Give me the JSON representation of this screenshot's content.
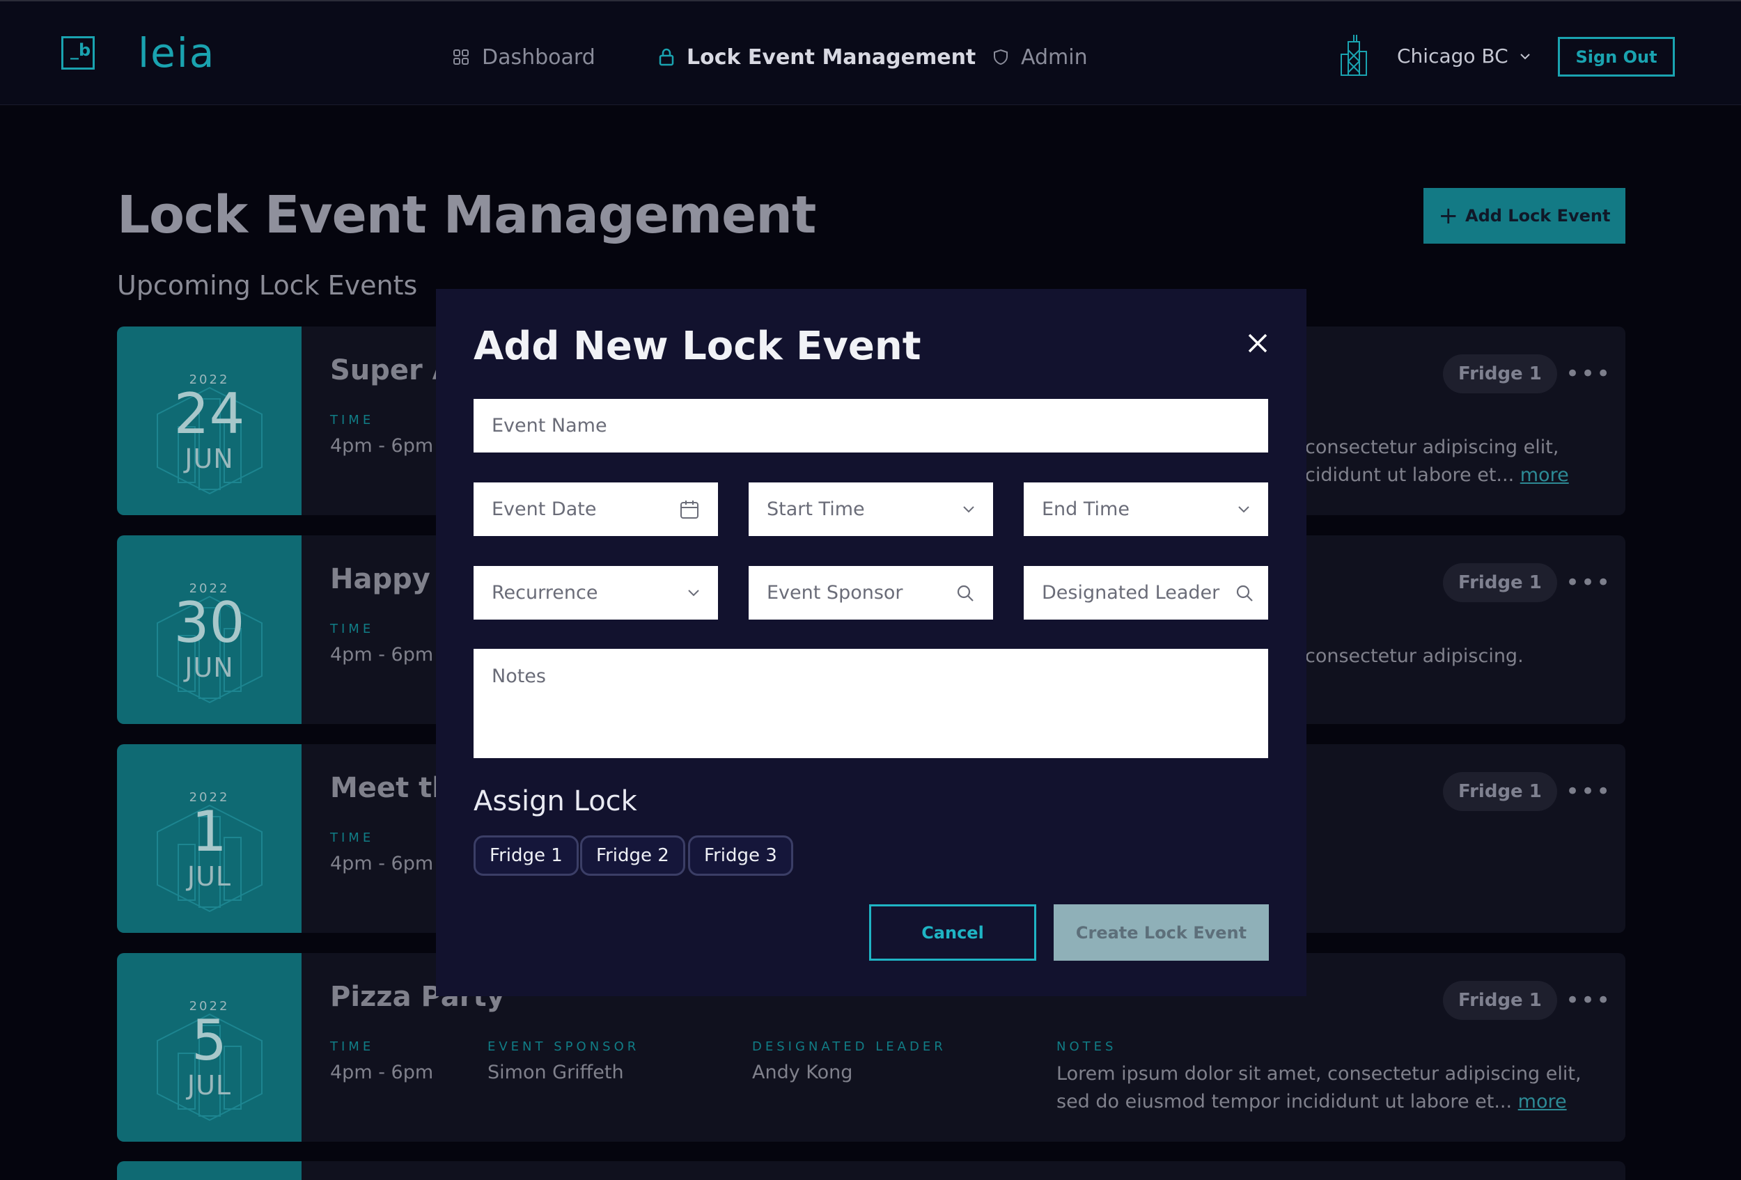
{
  "header": {
    "logo_mark": "_b",
    "logo_text": "leia",
    "nav": [
      {
        "label": "Dashboard",
        "icon": "grid-icon"
      },
      {
        "label": "Lock Event Management",
        "icon": "lock-icon"
      },
      {
        "label": "Admin",
        "icon": "shield-icon"
      }
    ],
    "city": "Chicago BC",
    "sign_out": "Sign Out"
  },
  "page": {
    "title": "Lock Event Management",
    "add_button": "Add Lock Event",
    "subtitle": "Upcoming Lock Events"
  },
  "events": [
    {
      "year": "2022",
      "day": "24",
      "month": "JUN",
      "name": "Super Av",
      "time_label": "TIME",
      "time": "4pm - 6pm",
      "notes_line1": "consectetur adipiscing elit,",
      "notes_line2": "cididunt ut labore et...",
      "more": "more",
      "lock": "Fridge 1",
      "menu": "•••"
    },
    {
      "year": "2022",
      "day": "30",
      "month": "JUN",
      "name": "Happy H",
      "time_label": "TIME",
      "time": "4pm - 6pm",
      "notes_line1": "consectetur adipiscing.",
      "lock": "Fridge 1",
      "menu": "•••"
    },
    {
      "year": "2022",
      "day": "1",
      "month": "JUL",
      "name": "Meet the",
      "time_label": "TIME",
      "time": "4pm - 6pm",
      "lock": "Fridge 1",
      "menu": "•••"
    },
    {
      "year": "2022",
      "day": "5",
      "month": "JUL",
      "name": "Pizza Party",
      "time_label": "TIME",
      "time": "4pm - 6pm",
      "sponsor_label": "EVENT SPONSOR",
      "sponsor": "Simon Griffeth",
      "leader_label": "DESIGNATED LEADER",
      "leader": "Andy Kong",
      "notes_label": "NOTES",
      "notes_line1": "Lorem ipsum dolor sit amet, consectetur adipiscing elit,",
      "notes_line2": "sed do eiusmod tempor incididunt ut labore et...",
      "more": "more",
      "lock": "Fridge 1",
      "menu": "•••"
    }
  ],
  "modal": {
    "title": "Add New Lock Event",
    "event_name_placeholder": "Event Name",
    "event_date_placeholder": "Event Date",
    "start_time_placeholder": "Start Time",
    "end_time_placeholder": "End Time",
    "recurrence_placeholder": "Recurrence",
    "sponsor_placeholder": "Event Sponsor",
    "leader_placeholder": "Designated Leader",
    "notes_placeholder": "Notes",
    "assign_label": "Assign Lock",
    "locks": [
      "Fridge 1",
      "Fridge 2",
      "Fridge 3"
    ],
    "cancel": "Cancel",
    "create": "Create Lock Event"
  },
  "colors": {
    "accent": "#1aa3b0",
    "date_block": "#0f6a73",
    "modal_bg": "#12122e",
    "page_bg": "#05050e"
  }
}
